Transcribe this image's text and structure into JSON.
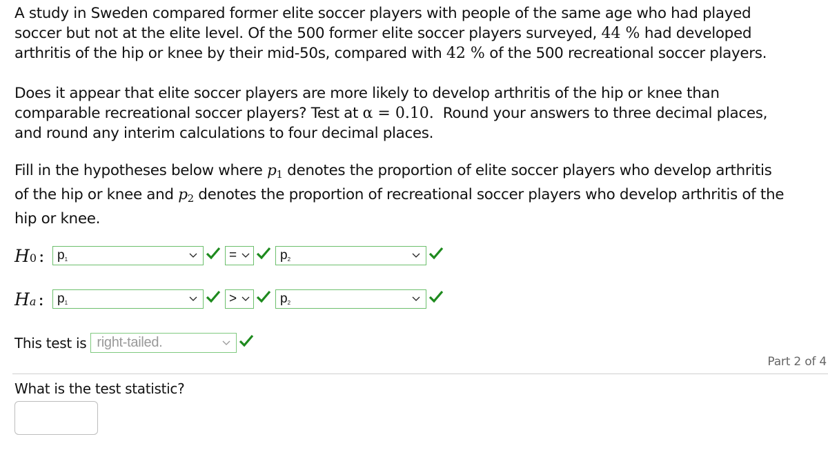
{
  "problem": {
    "paragraph1": {
      "line1": "A study in Sweden compared former elite soccer players with people of the same age who had played",
      "line2_a": "soccer but not at the elite level. Of the 500 former elite soccer players surveyed, ",
      "pct1": "44 %",
      "line2_b": " had developed",
      "line3_a": "arthritis of the hip or knee by their mid-50s, compared with ",
      "pct2": "42 %",
      "line3_b": " of the 500 recreational soccer players."
    },
    "paragraph2": {
      "line1": "Does it appear that elite soccer players are more likely to develop arthritis of the hip or knee than",
      "line2_a": "comparable recreational soccer players? Test at ",
      "alpha": "α = 0.10.",
      "line2_b": "  Round your answers to three decimal places,",
      "line3": "and round any interim calculations to four decimal places."
    },
    "paragraph3": {
      "line1_a": "Fill in the hypotheses below where ",
      "p1_var": "p",
      "p1_sub": "1",
      "line1_b": " denotes the proportion of elite soccer players who develop arthritis",
      "line2_a": "of the hip or knee and ",
      "p2_var": "p",
      "p2_sub": "2",
      "line2_b": " denotes the proportion of recreational soccer players who develop arthritis of the",
      "line3": "hip or knee."
    }
  },
  "hypotheses": {
    "null": {
      "label": "H",
      "label_sub": "0",
      "colon": ":",
      "left": {
        "text": "p",
        "sub": "1"
      },
      "operator": "=",
      "right": {
        "text": "p",
        "sub": "2"
      },
      "status": "correct"
    },
    "alternative": {
      "label": "H",
      "label_sub": "a",
      "colon": ":",
      "left": {
        "text": "p",
        "sub": "1"
      },
      "operator": ">",
      "right": {
        "text": "p",
        "sub": "2"
      },
      "status": "correct"
    }
  },
  "test_type": {
    "label": "This test is",
    "value": "right-tailed.",
    "status": "correct"
  },
  "progress": {
    "part_label": "Part 2 of 4"
  },
  "question": {
    "text": "What is the test statistic?",
    "answer_value": ""
  },
  "colors": {
    "correct_check": "#1e8a1e",
    "dropdown_border": "#6cbf6c",
    "placeholder_text": "#999999"
  }
}
